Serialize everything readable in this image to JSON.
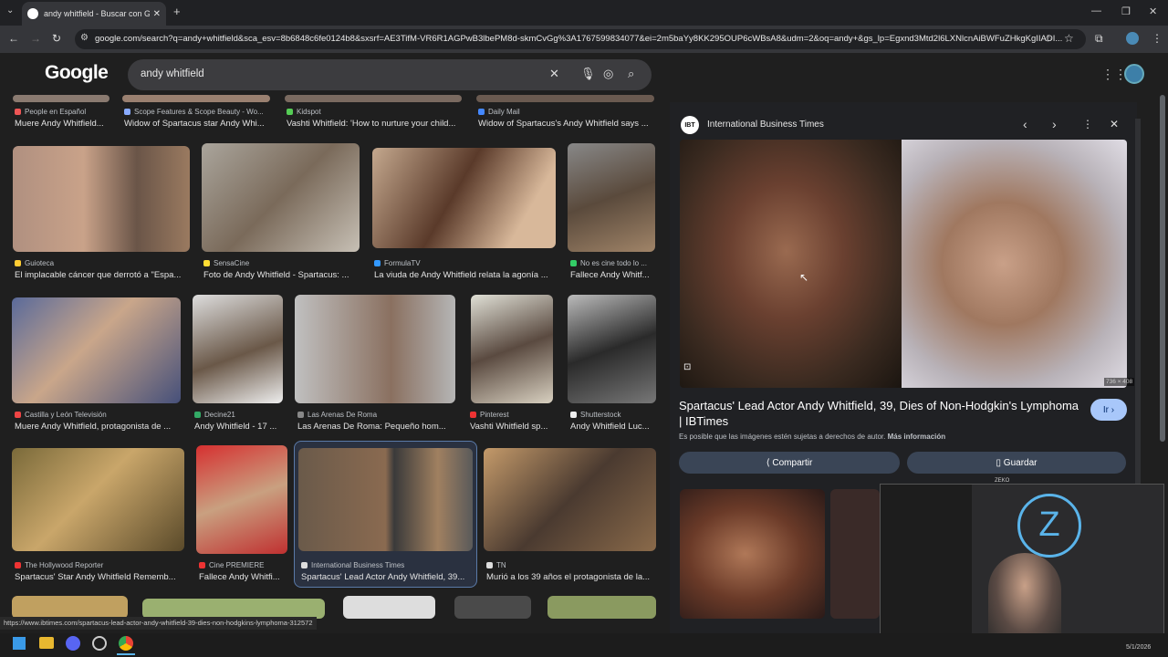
{
  "browser": {
    "tab_title": "andy whitfield - Buscar con Go...",
    "url": "google.com/search?q=andy+whitfield&sca_esv=8b6848c6fe0124b8&sxsrf=AE3TifM-VR6R1AGPwB3lbePM8d-skmCvGg%3A1767599834077&ei=2m5baYy8KK295OUP6cWBsA8&udm=2&oq=andy+&gs_lp=Egxnd3Mtd2l6LXNlcnAiBWFuZHkgKgIIADI...",
    "status_url": "https://www.ibtimes.com/spartacus-lead-actor-andy-whitfield-39-dies-non-hodgkins-lymphoma-312572"
  },
  "google": {
    "logo": "Google",
    "query": "andy whitfield"
  },
  "results_row0": [
    {
      "source": "People en Español",
      "caption": "Muere Andy Whitfield...",
      "color": "#e55"
    },
    {
      "source": "Scope Features & Scope Beauty - Wo...",
      "caption": "Widow of Spartacus star Andy Whi...",
      "color": "#8af"
    },
    {
      "source": "Kidspot",
      "caption": "Vashti Whitfield: 'How to nurture your child...",
      "color": "#5c5"
    },
    {
      "source": "Daily Mail",
      "caption": "Widow of Spartacus's Andy Whitfield says ...",
      "color": "#48f"
    }
  ],
  "results_row1": [
    {
      "source": "Guioteca",
      "caption": "El implacable cáncer que derrotó a \"Espa...",
      "color": "#fc3"
    },
    {
      "source": "SensaCine",
      "caption": "Foto de Andy Whitfield - Spartacus: ...",
      "color": "#fd3"
    },
    {
      "source": "FormulaTV",
      "caption": "La viuda de Andy Whitfield relata la agonía ...",
      "color": "#39f"
    },
    {
      "source": "No es cine todo lo ...",
      "caption": "Fallece Andy Whitf...",
      "color": "#3c6"
    }
  ],
  "results_row2": [
    {
      "source": "Castilla y León Televisión",
      "caption": "Muere Andy Whitfield, protagonista de ...",
      "color": "#e44"
    },
    {
      "source": "Decine21",
      "caption": "Andy Whitfield - 17 ...",
      "color": "#3a6"
    },
    {
      "source": "Las Arenas De Roma",
      "caption": "Las Arenas De Roma: Pequeño hom...",
      "color": "#888"
    },
    {
      "source": "Pinterest",
      "caption": "Vashti Whitfield sp...",
      "color": "#e33"
    },
    {
      "source": "Shutterstock",
      "caption": "Andy Whitfield Luc...",
      "color": "#eee"
    }
  ],
  "results_row3": [
    {
      "source": "The Hollywood Reporter",
      "caption": "Spartacus' Star Andy Whitfield Rememb...",
      "color": "#e33"
    },
    {
      "source": "Cine PREMIERE",
      "caption": "Fallece Andy Whitfi...",
      "color": "#e33"
    },
    {
      "source": "International Business Times",
      "caption": "Spartacus' Lead Actor Andy Whitfield, 39...",
      "color": "#ddd"
    },
    {
      "source": "TN",
      "caption": "Murió a los 39 años el protagonista de la...",
      "color": "#ddd"
    }
  ],
  "panel": {
    "source_badge": "IBT",
    "source": "International Business Times",
    "dimensions": "736 × 408",
    "title": "Spartacus' Lead Actor Andy Whitfield, 39, Dies of Non-Hodgkin's Lymphoma | IBTimes",
    "go_label": "Ir",
    "rights_text": "Es posible que las imágenes estén sujetas a derechos de autor.",
    "more_info": "Más información",
    "share_label": "Compartir",
    "save_label": "Guardar"
  },
  "overlay": {
    "label": "ZEKO",
    "date": "5/1/2026"
  }
}
